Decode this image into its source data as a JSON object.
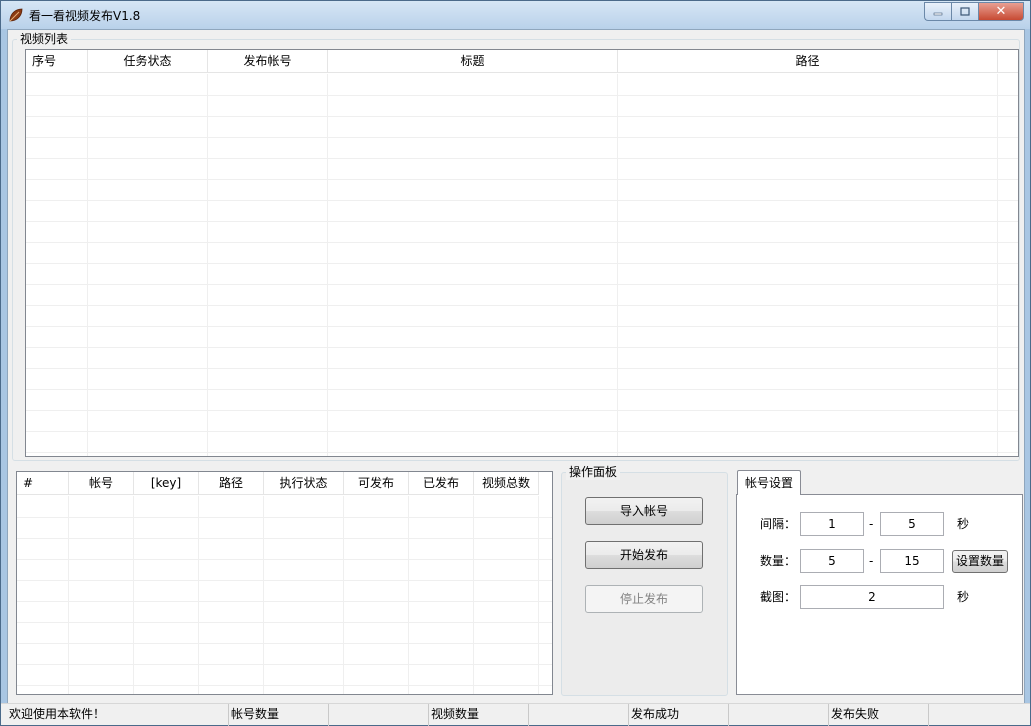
{
  "window": {
    "title": "看一看视频发布V1.8",
    "minimize_label": "▭",
    "maximize_label": "□",
    "close_label": "✕"
  },
  "video_list": {
    "group_title": "视频列表",
    "columns": [
      "序号",
      "任务状态",
      "发布帐号",
      "标题",
      "路径"
    ]
  },
  "account_list": {
    "columns": [
      "#",
      "帐号",
      "[key]",
      "路径",
      "执行状态",
      "可发布",
      "已发布",
      "视频总数"
    ]
  },
  "operation_panel": {
    "group_title": "操作面板",
    "import_label": "导入帐号",
    "start_label": "开始发布",
    "stop_label": "停止发布"
  },
  "account_settings": {
    "tab_label": "帐号设置",
    "interval_label": "间隔：",
    "interval_min": "1",
    "interval_max": "5",
    "interval_dash": "-",
    "interval_unit": "秒",
    "count_label": "数量：",
    "count_min": "5",
    "count_max": "15",
    "count_dash": "-",
    "set_count_label": "设置数量",
    "screenshot_label": "截图：",
    "screenshot_value": "2",
    "screenshot_unit": "秒"
  },
  "statusbar": {
    "welcome": "欢迎使用本软件！",
    "account_count": "帐号数量",
    "video_count": "视频数量",
    "publish_success": "发布成功",
    "publish_fail": "发布失败"
  }
}
